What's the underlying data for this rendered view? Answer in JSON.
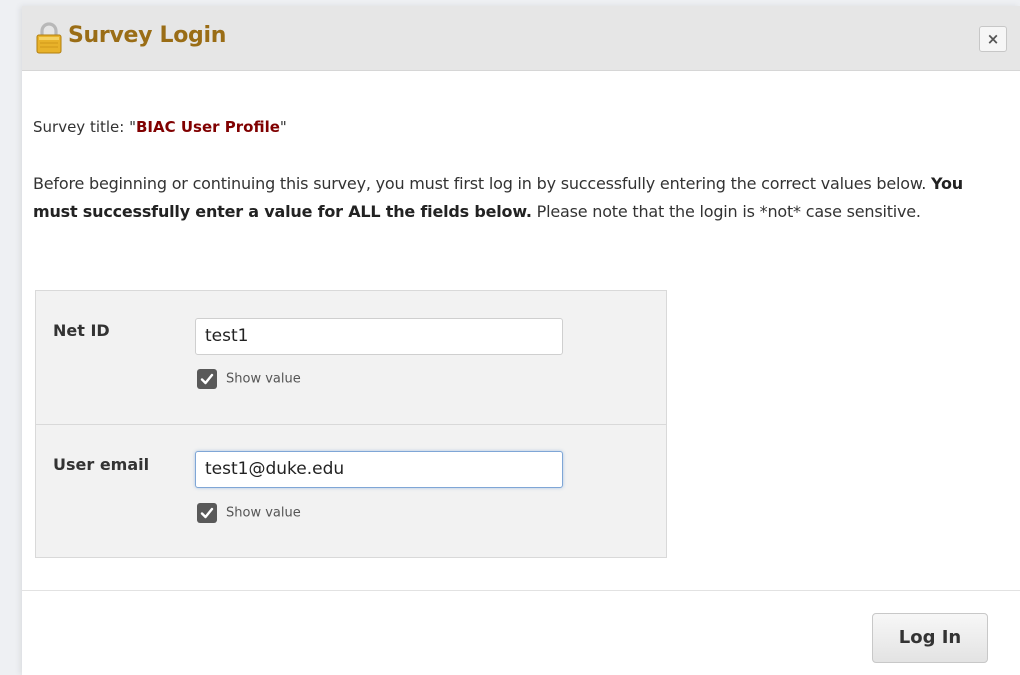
{
  "dialog": {
    "title": "Survey Login",
    "close_label": "×"
  },
  "survey": {
    "title_prefix": "Survey title: \"",
    "title_name": "BIAC User Profile",
    "title_suffix": "\""
  },
  "instructions": {
    "part1": "Before beginning or continuing this survey, you must first log in by successfully entering the correct values below. ",
    "bold": "You must successfully enter a value for ALL the fields below.",
    "part2": " Please note that the login is *not* case sensitive."
  },
  "fields": [
    {
      "label": "Net ID",
      "value": "test1",
      "show_value_label": "Show value",
      "show_value_checked": true
    },
    {
      "label": "User email",
      "value": "test1@duke.edu",
      "show_value_label": "Show value",
      "show_value_checked": true
    }
  ],
  "footer": {
    "login_label": "Log In"
  },
  "icons": {
    "title_icon": "lock-icon",
    "close_icon": "close-icon",
    "checkbox_icon": "checkmark-icon"
  },
  "colors": {
    "title": "#9a6d16",
    "survey_name": "#800000",
    "checkbox": "#595959"
  }
}
